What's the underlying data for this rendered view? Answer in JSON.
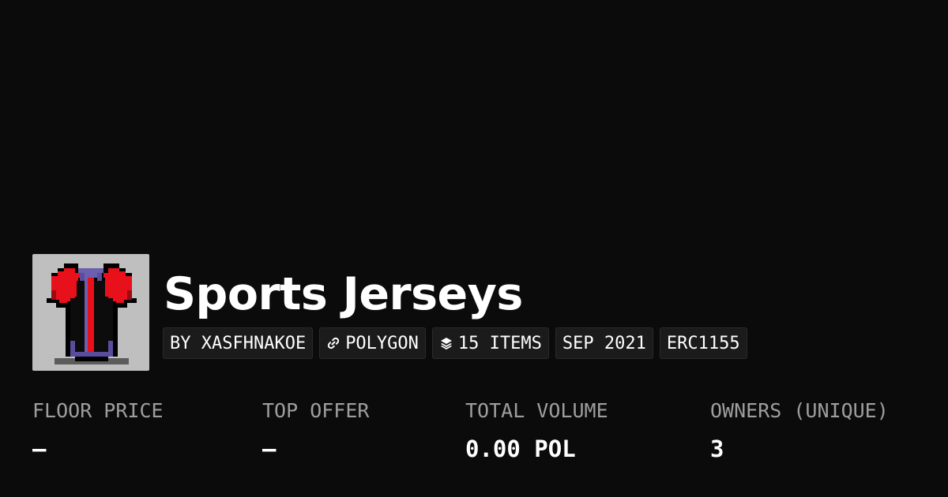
{
  "collection": {
    "name": "Sports Jerseys",
    "thumbnail_icon": "red-black-jersey-pixel-art"
  },
  "chips": {
    "creator": "BY XASFHNAKOE",
    "chain": "POLYGON",
    "chain_icon": "polygon-link-icon",
    "items": "15 ITEMS",
    "items_icon": "layers-icon",
    "date": "SEP 2021",
    "standard": "ERC1155"
  },
  "stats": {
    "floor_price": {
      "label": "FLOOR PRICE",
      "value": "–"
    },
    "top_offer": {
      "label": "TOP OFFER",
      "value": "–"
    },
    "total_volume": {
      "label": "TOTAL VOLUME",
      "value": "0.00 POL"
    },
    "owners": {
      "label": "OWNERS (UNIQUE)",
      "value": "3"
    }
  },
  "colors": {
    "background": "#0b0b0b",
    "text": "#ffffff",
    "muted_label": "#9e9e9e",
    "chip_background": "#1b1b1b",
    "thumbnail_background": "#bfbfbf"
  }
}
